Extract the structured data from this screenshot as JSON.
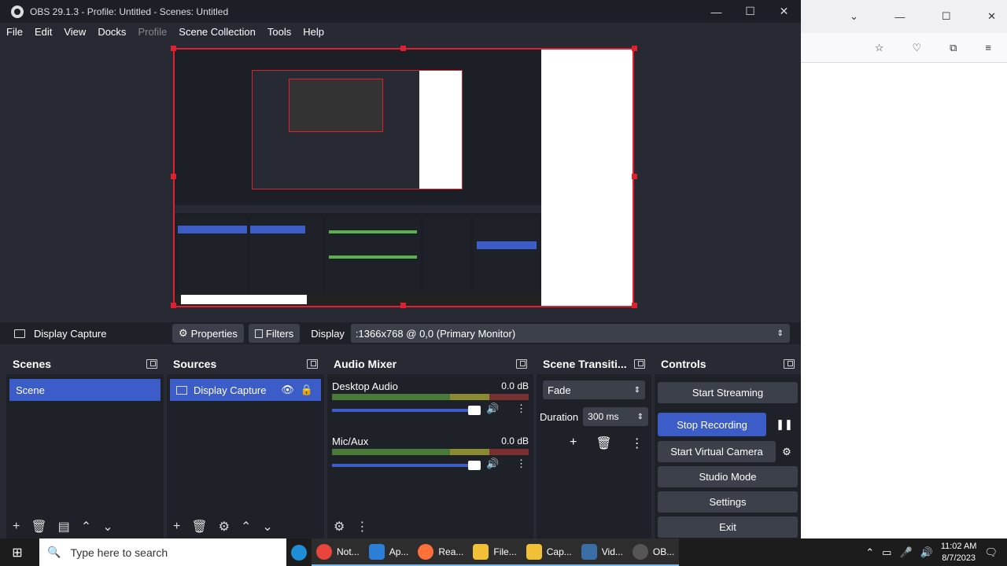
{
  "window": {
    "title": "OBS 29.1.3 - Profile: Untitled - Scenes: Untitled",
    "minimize": "—",
    "maximize": "☐",
    "close": "✕"
  },
  "menu": [
    "File",
    "Edit",
    "View",
    "Docks",
    "Profile",
    "Scene Collection",
    "Tools",
    "Help"
  ],
  "sourcebar": {
    "source_name": "Display Capture",
    "properties": "Properties",
    "filters": "Filters",
    "display_label": "Display",
    "display_value": ":1366x768 @ 0,0 (Primary Monitor)"
  },
  "scenes": {
    "title": "Scenes",
    "items": [
      "Scene"
    ]
  },
  "sources": {
    "title": "Sources",
    "items": [
      "Display Capture"
    ]
  },
  "mixer": {
    "title": "Audio Mixer",
    "channels": [
      {
        "name": "Desktop Audio",
        "db": "0.0 dB"
      },
      {
        "name": "Mic/Aux",
        "db": "0.0 dB"
      }
    ],
    "scale": [
      "-60",
      "-55",
      "-50",
      "-45",
      "-40",
      "-35",
      "-30",
      "-25",
      "-20",
      "-15",
      "-10",
      "-5",
      "0"
    ]
  },
  "transitions": {
    "title": "Scene Transiti...",
    "selected": "Fade",
    "duration_label": "Duration",
    "duration_value": "300 ms"
  },
  "controls": {
    "title": "Controls",
    "start_streaming": "Start Streaming",
    "stop_recording": "Stop Recording",
    "start_virtual_camera": "Start Virtual Camera",
    "studio_mode": "Studio Mode",
    "settings": "Settings",
    "exit": "Exit"
  },
  "taskbar": {
    "search_placeholder": "Type here to search",
    "apps": [
      {
        "label": "Not...",
        "color": "#e8453c"
      },
      {
        "label": "Ap...",
        "color": "#2b7fd6"
      },
      {
        "label": "Rea...",
        "color": "#ff7139"
      },
      {
        "label": "File...",
        "color": "#f2c037"
      },
      {
        "label": "Cap...",
        "color": "#f2c037"
      },
      {
        "label": "Vid...",
        "color": "#3a6ea5"
      },
      {
        "label": "OB...",
        "color": "#555"
      }
    ],
    "time": "11:02 AM",
    "date": "8/7/2023"
  },
  "colors": {
    "accent": "#3c5cc7",
    "selection": "#e0202e"
  }
}
